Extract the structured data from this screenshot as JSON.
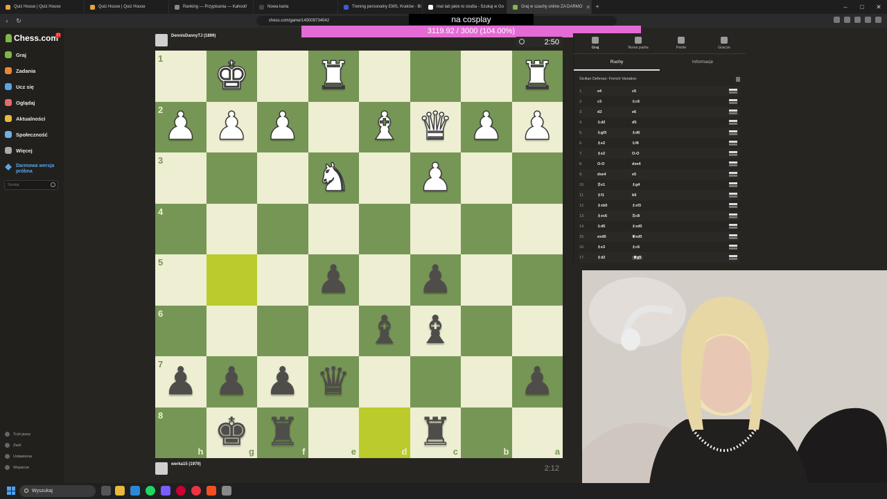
{
  "browser": {
    "tabs": [
      {
        "title": "Quiz House | Quiz House",
        "color": "#e8a33b"
      },
      {
        "title": "Quiz House | Quiz House",
        "color": "#e8a33b"
      },
      {
        "title": "Ranking — Przypisania — Kahoot!",
        "color": "#888888"
      },
      {
        "title": "Nowa karta",
        "color": "#444444"
      },
      {
        "title": "Trening personalny EMS, Kraków - Bi",
        "color": "#3b5bdb"
      },
      {
        "title": "mat lab jakie to studia - Szukaj w Go",
        "color": "#ffffff"
      },
      {
        "title": "Graj w szachy online ZA DARMO",
        "color": "#81b64c",
        "active": true
      }
    ],
    "url": "chess.com/game/145009734042"
  },
  "overlay": {
    "title": "na cosplay",
    "progress_text": "3119.92 / 3000 (104.00%)",
    "progress_pct": 104.0
  },
  "sidebar": {
    "logo": "Chess.com",
    "badge": "17",
    "items": [
      {
        "label": "Graj",
        "color": "#81b64c"
      },
      {
        "label": "Zadania",
        "color": "#e8863a"
      },
      {
        "label": "Ucz się",
        "color": "#5aa5e8"
      },
      {
        "label": "Oglądaj",
        "color": "#e86b6b"
      },
      {
        "label": "Aktualności",
        "color": "#e8b93a"
      },
      {
        "label": "Społeczność",
        "color": "#6fb0e8"
      },
      {
        "label": "Więcej",
        "color": "#aaaaaa"
      }
    ],
    "trial": "Darmowa wersja próbna",
    "search_placeholder": "Szukaj",
    "bottom": [
      "Tryb jasny",
      "Zwiń",
      "Ustawienia",
      "Wsparcie"
    ]
  },
  "players": {
    "top": {
      "name": "DennisDannyTJ (1899)",
      "clock": "2:50"
    },
    "bottom": {
      "name": "werka15 (1979)",
      "clock": "2:12"
    }
  },
  "board": {
    "rank_labels": [
      "1",
      "2",
      "3",
      "4",
      "5",
      "6",
      "7",
      "8"
    ],
    "file_labels": [
      "h",
      "g",
      "f",
      "e",
      "d",
      "c",
      "b",
      "a"
    ],
    "highlight": [
      [
        4,
        1
      ],
      [
        7,
        4
      ]
    ],
    "position": [
      [
        "",
        "wK",
        "",
        "wR",
        "",
        "",
        "",
        "wR"
      ],
      [
        "wP",
        "wP",
        "wP",
        "",
        "wB",
        "wQ",
        "wP",
        "wP"
      ],
      [
        "",
        "",
        "",
        "wN",
        "",
        "wP",
        "",
        ""
      ],
      [
        "",
        "",
        "",
        "",
        "",
        "",
        "",
        ""
      ],
      [
        "",
        "",
        "",
        "bP",
        "",
        "bP",
        "",
        ""
      ],
      [
        "",
        "",
        "",
        "",
        "bB",
        "bB",
        "",
        ""
      ],
      [
        "bP",
        "bP",
        "bP",
        "bQ",
        "",
        "",
        "",
        "bP"
      ],
      [
        "",
        "bK",
        "bR",
        "",
        "",
        "bR",
        "",
        ""
      ]
    ]
  },
  "panel": {
    "tabs": [
      "Graj",
      "Nowa partia",
      "Partie",
      "Gracze"
    ],
    "subtabs": [
      "Ruchy",
      "Informacje"
    ],
    "opening": "Sicilian Defense: French Variation",
    "moves": [
      [
        "1.",
        "e4",
        "c5"
      ],
      [
        "2.",
        "c3",
        "♘c6"
      ],
      [
        "3.",
        "d3",
        "e6"
      ],
      [
        "4.",
        "♘d2",
        "d5"
      ],
      [
        "5.",
        "♘gf3",
        "♗d6"
      ],
      [
        "6.",
        "♗e2",
        "♘f6"
      ],
      [
        "7.",
        "♗e2",
        "O-O"
      ],
      [
        "8.",
        "O-O",
        "dxe4"
      ],
      [
        "9.",
        "dxe4",
        "e5"
      ],
      [
        "10.",
        "♖e1",
        "♗g4"
      ],
      [
        "11.",
        "♗f1",
        "b5"
      ],
      [
        "12.",
        "♗xb5",
        "♗xf3"
      ],
      [
        "13.",
        "♗xc6",
        "♖c8"
      ],
      [
        "14.",
        "♘d5",
        "♗xd5"
      ],
      [
        "15.",
        "exd5",
        "♕xd5"
      ],
      [
        "16.",
        "♗e3",
        "♗c6"
      ],
      [
        "17.",
        "♗d2",
        "♕g5"
      ]
    ]
  },
  "taskbar": {
    "search": "Wyszukaj"
  }
}
